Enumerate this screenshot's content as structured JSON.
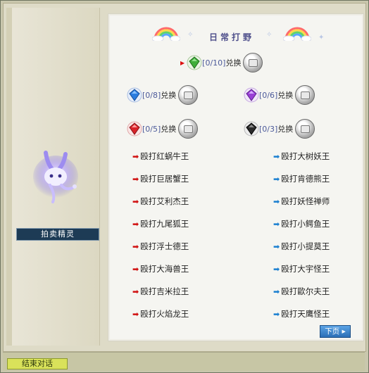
{
  "npc": {
    "name": "拍卖精灵"
  },
  "header": {
    "title": "日常打野"
  },
  "exchanges": [
    {
      "count": "[0/10]",
      "label": "兑换",
      "gem_color": "#3fae3a",
      "gem": "green-gem-icon"
    },
    {
      "count": "[0/8]",
      "label": "兑换",
      "gem_color": "#2b7de0",
      "gem": "blue-gem-icon"
    },
    {
      "count": "[0/6]",
      "label": "兑换",
      "gem_color": "#9a3fd6",
      "gem": "purple-gem-icon"
    },
    {
      "count": "[0/5]",
      "label": "兑换",
      "gem_color": "#d8232a",
      "gem": "red-gem-icon"
    },
    {
      "count": "[0/3]",
      "label": "兑换",
      "gem_color": "#2a2a2a",
      "gem": "black-gem-icon"
    }
  ],
  "tasks_left": [
    "殴打红蜗牛王",
    "殴打巨居蟹王",
    "殴打艾利杰王",
    "殴打九尾狐王",
    "殴打浮士德王",
    "殴打大海兽王",
    "殴打吉米拉王",
    "殴打火焰龙王"
  ],
  "tasks_right": [
    "殴打大树妖王",
    "殴打肯德熊王",
    "殴打妖怪禅师",
    "殴打小鳄鱼王",
    "殴打小提莫王",
    "殴打大宇怪王",
    "殴打歐尔夫王",
    "殴打天鹰怪王"
  ],
  "buttons": {
    "next": "下页",
    "end": "结束对话"
  },
  "colors": {
    "red_arrow": "#d01010",
    "blue_arrow": "#1a7fd0",
    "title": "#4d4e8a"
  }
}
